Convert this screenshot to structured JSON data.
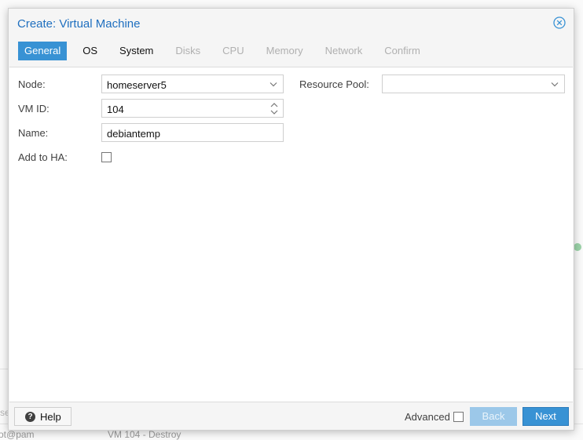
{
  "background": {
    "user_text": "ot@pam",
    "task_text": "VM 104 - Destroy",
    "side_text": "se"
  },
  "dialog": {
    "title": "Create: Virtual Machine",
    "close_icon": "close-circle-icon"
  },
  "tabs": [
    {
      "label": "General",
      "state": "active"
    },
    {
      "label": "OS",
      "state": "enabled"
    },
    {
      "label": "System",
      "state": "enabled"
    },
    {
      "label": "Disks",
      "state": "disabled"
    },
    {
      "label": "CPU",
      "state": "disabled"
    },
    {
      "label": "Memory",
      "state": "disabled"
    },
    {
      "label": "Network",
      "state": "disabled"
    },
    {
      "label": "Confirm",
      "state": "disabled"
    }
  ],
  "form": {
    "node": {
      "label": "Node:",
      "value": "homeserver5"
    },
    "vmid": {
      "label": "VM ID:",
      "value": "104"
    },
    "name": {
      "label": "Name:",
      "value": "debiantemp"
    },
    "ha": {
      "label": "Add to HA:",
      "checked": false
    },
    "pool": {
      "label": "Resource Pool:",
      "value": ""
    }
  },
  "footer": {
    "help_label": "Help",
    "help_icon": "question-circle-icon",
    "advanced_label": "Advanced",
    "advanced_checked": false,
    "back_label": "Back",
    "next_label": "Next"
  },
  "colors": {
    "accent": "#3892d4",
    "title": "#1f6fbf",
    "disabled_button": "#9cc8e9"
  }
}
